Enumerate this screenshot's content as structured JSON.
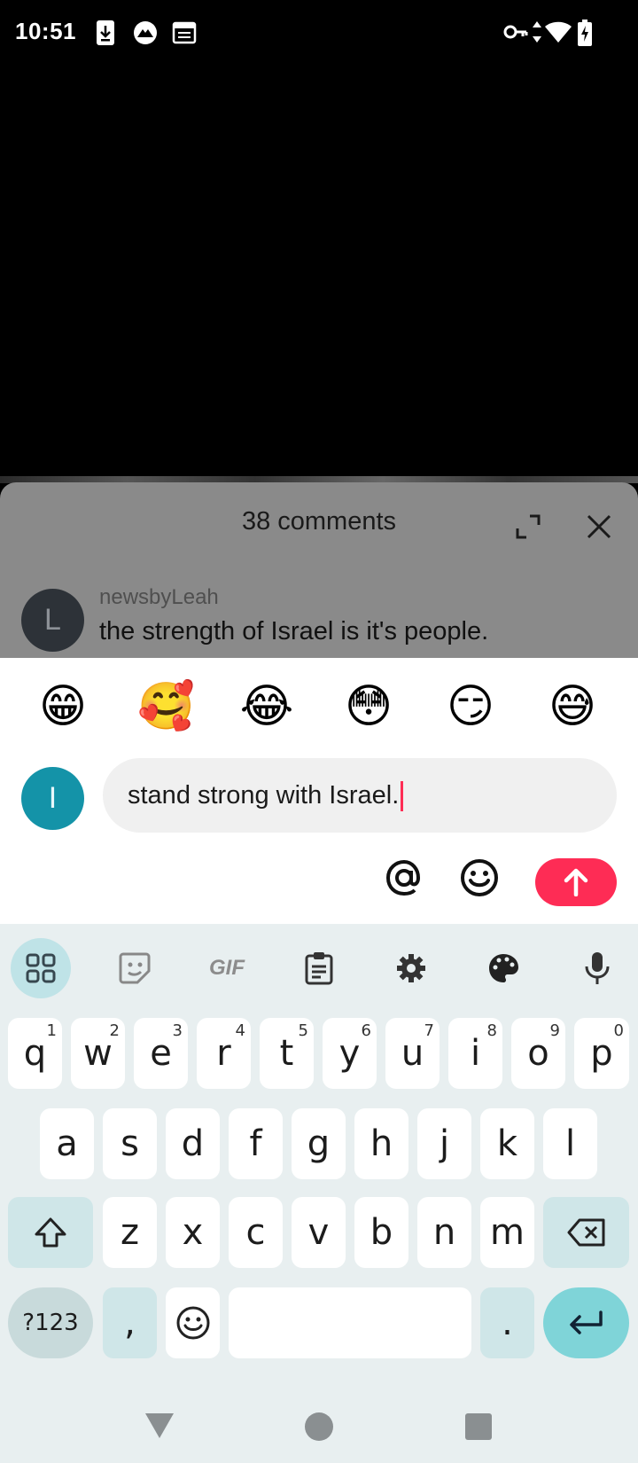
{
  "status_bar": {
    "time": "10:51",
    "left_icons": [
      "download-icon",
      "incognito-icon",
      "calendar-icon"
    ],
    "right_icons": [
      "vpn-key-icon",
      "data-arrows-icon",
      "wifi-icon",
      "battery-charging-icon"
    ]
  },
  "comments_sheet": {
    "title": "38 comments",
    "comment": {
      "avatar_letter": "L",
      "username": "newsbyLeah",
      "text": "the strength of Israel is it's people."
    }
  },
  "compose": {
    "quick_emojis": [
      "😁",
      "🥰",
      "😂",
      "😳",
      "😏",
      "😅"
    ],
    "avatar_letter": "I",
    "input_value": "stand strong with Israel.",
    "actions": [
      "at-mention-icon",
      "emoji-icon",
      "send-icon"
    ]
  },
  "keyboard": {
    "toolbar": [
      "apps-grid-icon",
      "sticker-icon",
      "gif-icon",
      "clipboard-icon",
      "settings-gear-icon",
      "theme-palette-icon",
      "microphone-icon"
    ],
    "gif_label": "GIF",
    "row1": [
      {
        "k": "q",
        "h": "1"
      },
      {
        "k": "w",
        "h": "2"
      },
      {
        "k": "e",
        "h": "3"
      },
      {
        "k": "r",
        "h": "4"
      },
      {
        "k": "t",
        "h": "5"
      },
      {
        "k": "y",
        "h": "6"
      },
      {
        "k": "u",
        "h": "7"
      },
      {
        "k": "i",
        "h": "8"
      },
      {
        "k": "o",
        "h": "9"
      },
      {
        "k": "p",
        "h": "0"
      }
    ],
    "row2": [
      "a",
      "s",
      "d",
      "f",
      "g",
      "h",
      "j",
      "k",
      "l"
    ],
    "row3": [
      "z",
      "x",
      "c",
      "v",
      "b",
      "n",
      "m"
    ],
    "sym_label": "?123",
    "comma": ",",
    "period": "."
  },
  "colors": {
    "accent": "#fe2c55",
    "my_avatar": "#1493a8",
    "keyboard_bg": "#e8eff0"
  }
}
